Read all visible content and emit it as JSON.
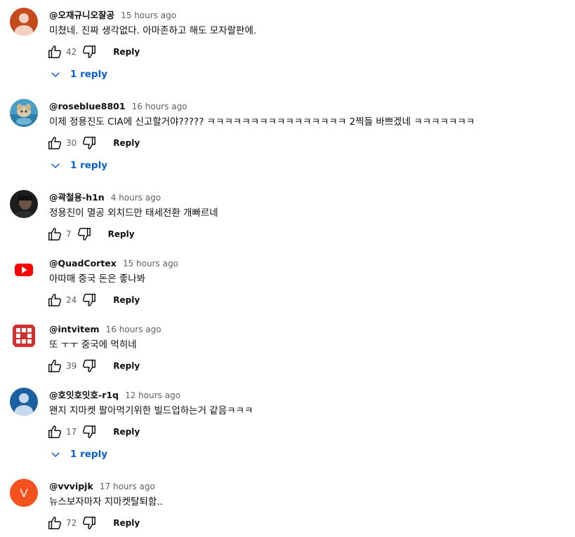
{
  "ui": {
    "reply_label": "Reply",
    "reply_count_label": "1 reply"
  },
  "colors": {
    "link_blue": "#065fd4",
    "meta_gray": "#606060"
  },
  "comments": [
    {
      "author": "@오재규니오잘공",
      "time": "15 hours ago",
      "text": "미쳤네. 진짜 생각없다. 아마존하고 해도 모자랄판에.",
      "likes": "42",
      "avatar": "default-avatar-icon",
      "avatar_color": "#c64a1c",
      "replies": "1 reply"
    },
    {
      "author": "@roseblue8801",
      "time": "16 hours ago",
      "text": "이제 정용진도 CIA에 신고할거야????? ㅋㅋㅋㅋㅋㅋㅋㅋㅋㅋㅋㅋㅋㅋㅋㅋ 2찍들 바쁘겠네 ㅋㅋㅋㅋㅋㅋㅋ",
      "likes": "30",
      "avatar": "photo-avatar",
      "replies": "1 reply"
    },
    {
      "author": "@곽철용-h1n",
      "time": "4 hours ago",
      "text": "정용진이 멸공 외치드만 태세전환 개빠르네",
      "likes": "7",
      "avatar": "photo-avatar"
    },
    {
      "author": "@QuadCortex",
      "time": "15 hours ago",
      "text": "아따매 중국 돈은 좋나봐",
      "likes": "24",
      "avatar": "youtube-logo-icon"
    },
    {
      "author": "@intvitem",
      "time": "16 hours ago",
      "text": "또 ㅜㅜ 중국에 먹히네",
      "likes": "39",
      "avatar": "grid-pattern-avatar"
    },
    {
      "author": "@호잇호잇호-r1q",
      "time": "12 hours ago",
      "text": "왠지 지마켓 팔아먹기위한 빌드업하는거 같음ㅋㅋㅋ",
      "likes": "17",
      "avatar": "default-avatar-icon",
      "avatar_color": "#1a5fa0",
      "replies": "1 reply"
    },
    {
      "author": "@vvvipjk",
      "time": "17 hours ago",
      "text": "뉴스보자마자 지마켓탈퇴함..",
      "likes": "72",
      "avatar": "letter-avatar",
      "avatar_letter": "V",
      "avatar_color": "#f4511e"
    }
  ]
}
